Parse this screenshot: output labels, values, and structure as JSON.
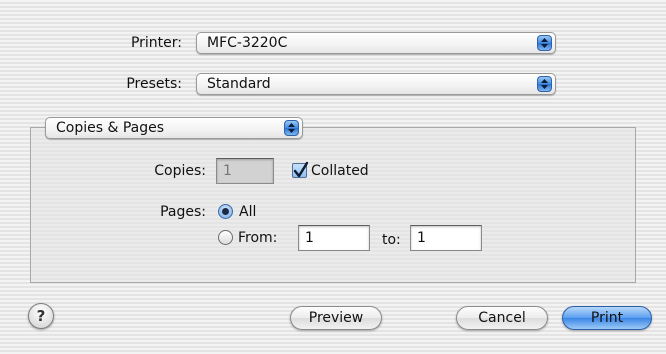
{
  "printer": {
    "label": "Printer:",
    "value": "MFC-3220C"
  },
  "presets": {
    "label": "Presets:",
    "value": "Standard"
  },
  "pane": {
    "value": "Copies & Pages"
  },
  "copies": {
    "label": "Copies:",
    "value": "1",
    "collated_label": "Collated",
    "collated": true
  },
  "pages": {
    "label": "Pages:",
    "all_label": "All",
    "from_label": "From:",
    "from_value": "1",
    "to_label": "to:",
    "to_value": "1",
    "selected": "All"
  },
  "buttons": {
    "help": "?",
    "preview": "Preview",
    "cancel": "Cancel",
    "print": "Print"
  },
  "colors": {
    "accent": "#3a86e6",
    "background": "#ececec"
  }
}
